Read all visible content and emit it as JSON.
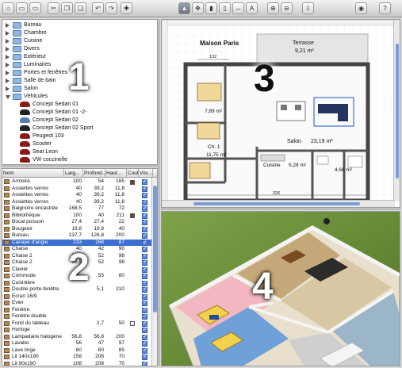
{
  "toolbar": {
    "buttons": [
      "new-home",
      "open",
      "save",
      "cut",
      "copy",
      "paste",
      "undo",
      "redo",
      "add-furniture",
      "select",
      "pan",
      "create-walls",
      "create-rooms",
      "create-dimensions",
      "add-text",
      "zoom-in",
      "zoom-out",
      "import-furniture",
      "create-photo",
      "help"
    ]
  },
  "catalog": {
    "categories": [
      {
        "label": "Bureau",
        "expanded": false
      },
      {
        "label": "Chambre",
        "expanded": false
      },
      {
        "label": "Cuisine",
        "expanded": false
      },
      {
        "label": "Divers",
        "expanded": false
      },
      {
        "label": "Extérieur",
        "expanded": false
      },
      {
        "label": "Luminaires",
        "expanded": false
      },
      {
        "label": "Portes et fenêtres",
        "expanded": false
      },
      {
        "label": "Salle de bain",
        "expanded": false
      },
      {
        "label": "Salon",
        "expanded": false
      },
      {
        "label": "Véhicules",
        "expanded": true
      }
    ],
    "vehicles": [
      {
        "label": "Concept Sedan 01",
        "icon": "car-red-icon"
      },
      {
        "label": "Concept Sedan 01 -2-",
        "icon": "car-dark-icon"
      },
      {
        "label": "Concept Sedan 02",
        "icon": "car-blue-icon"
      },
      {
        "label": "Concept Sedan 02 Sport",
        "icon": "car-dark-icon"
      },
      {
        "label": "Peugeot 103",
        "icon": "scooter-icon"
      },
      {
        "label": "Scooter",
        "icon": "scooter-icon"
      },
      {
        "label": "Seat Leon",
        "icon": "car-red-icon"
      },
      {
        "label": "VW coccinelle",
        "icon": "car-red-icon"
      }
    ]
  },
  "furniture": {
    "columns": [
      "Nom",
      "Larg...",
      "Profond...",
      "Haut...",
      "Coul...",
      "Visi..."
    ],
    "rows": [
      {
        "name": "Armoire",
        "w": "100",
        "d": "54",
        "h": "165",
        "color": "#7a3b1a",
        "selected": false
      },
      {
        "name": "Assiettes verres",
        "w": "40",
        "d": "39,2",
        "h": "11,8",
        "color": "",
        "selected": false
      },
      {
        "name": "Assiettes verres",
        "w": "40",
        "d": "39,2",
        "h": "11,8",
        "color": "",
        "selected": false
      },
      {
        "name": "Assiettes verres",
        "w": "40",
        "d": "39,2",
        "h": "11,8",
        "color": "",
        "selected": false
      },
      {
        "name": "Baignoire encastrée",
        "w": "168,5",
        "d": "77",
        "h": "72",
        "color": "",
        "selected": false
      },
      {
        "name": "Bibliothèque",
        "w": "100",
        "d": "40",
        "h": "211",
        "color": "#7a3b1a",
        "selected": false
      },
      {
        "name": "Bocal poisson",
        "w": "27,4",
        "d": "27,4",
        "h": "22",
        "color": "",
        "selected": false
      },
      {
        "name": "Bougeoir",
        "w": "19,8",
        "d": "19,8",
        "h": "40",
        "color": "",
        "selected": false
      },
      {
        "name": "Bureau",
        "w": "137,7",
        "d": "126,8",
        "h": "200",
        "color": "",
        "selected": false
      },
      {
        "name": "Canapé d'angle",
        "w": "233",
        "d": "168",
        "h": "87",
        "color": "",
        "selected": true
      },
      {
        "name": "Chaise",
        "w": "40",
        "d": "42",
        "h": "90",
        "color": "",
        "selected": false
      },
      {
        "name": "Chaise 2",
        "w": "38,5",
        "d": "52",
        "h": "98",
        "color": "",
        "selected": false
      },
      {
        "name": "Chaise 2",
        "w": "38,5",
        "d": "52",
        "h": "98",
        "color": "",
        "selected": false
      },
      {
        "name": "Clavier",
        "w": "",
        "d": "",
        "h": "",
        "color": "",
        "selected": false
      },
      {
        "name": "Commode",
        "w": "",
        "d": "55",
        "h": "80",
        "color": "",
        "selected": false
      },
      {
        "name": "Cuisinière",
        "w": "",
        "d": "",
        "h": "",
        "color": "",
        "selected": false
      },
      {
        "name": "Double porte-fenêtre",
        "w": "",
        "d": "5,1",
        "h": "210",
        "color": "",
        "selected": false
      },
      {
        "name": "Ecran 16/9",
        "w": "",
        "d": "",
        "h": "",
        "color": "",
        "selected": false
      },
      {
        "name": "Evier",
        "w": "",
        "d": "",
        "h": "",
        "color": "",
        "selected": false
      },
      {
        "name": "Fenêtre",
        "w": "",
        "d": "",
        "h": "",
        "color": "",
        "selected": false
      },
      {
        "name": "Fenêtre double",
        "w": "",
        "d": "",
        "h": "",
        "color": "",
        "selected": false
      },
      {
        "name": "Fond du tableau",
        "w": "",
        "d": "2,7",
        "h": "50",
        "color": "#eeeeee",
        "selected": false
      },
      {
        "name": "Horloge",
        "w": "",
        "d": "",
        "h": "",
        "color": "",
        "selected": false
      },
      {
        "name": "Lampadaire halogène",
        "w": "56,8",
        "d": "56,8",
        "h": "200",
        "color": "",
        "selected": false
      },
      {
        "name": "Lavabo",
        "w": "56",
        "d": "47",
        "h": "97",
        "color": "",
        "selected": false
      },
      {
        "name": "Lave linge",
        "w": "60",
        "d": "60",
        "h": "85",
        "color": "",
        "selected": false
      },
      {
        "name": "Lit 140x190",
        "w": "158",
        "d": "208",
        "h": "70",
        "color": "",
        "selected": false
      },
      {
        "name": "Lit 90x190",
        "w": "108",
        "d": "208",
        "h": "70",
        "color": "",
        "selected": false
      }
    ]
  },
  "plan": {
    "house_name": "Maison Paris",
    "rooms": [
      {
        "name": "Terrasse",
        "area": "9,21 m²"
      },
      {
        "name": "",
        "area": "7,89 m²"
      },
      {
        "name": "Salon",
        "area": "23,19 m²"
      },
      {
        "name": "Ch. 1",
        "area": "11,75 m²"
      },
      {
        "name": "Cuisine",
        "area": "5,28 m²"
      },
      {
        "name": "",
        "area": "4,68 m²"
      }
    ],
    "dimensions": [
      "132",
      "326"
    ]
  },
  "callouts": [
    "1",
    "2",
    "3",
    "4"
  ],
  "colors": {
    "selection": "#3c6fcf",
    "accent_blue": "#5b85d6"
  }
}
